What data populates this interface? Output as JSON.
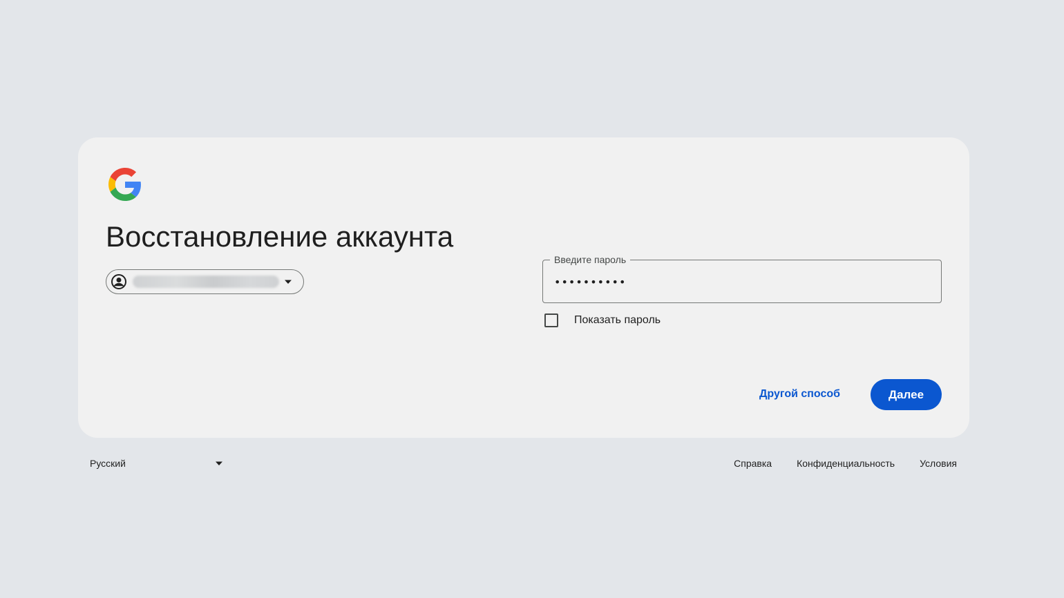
{
  "card": {
    "heading": "Восстановление аккаунта",
    "account": {
      "email": ""
    },
    "password_field": {
      "label": "Введите пароль",
      "value": "••••••••••"
    },
    "show_password": {
      "label": "Показать пароль",
      "checked": false
    },
    "actions": {
      "other_way_label": "Другой способ",
      "next_label": "Далее"
    }
  },
  "footer": {
    "language": "Русский",
    "links": {
      "help": "Справка",
      "privacy": "Конфиденциальность",
      "terms": "Условия"
    }
  },
  "colors": {
    "page_background": "#e3e6ea",
    "card_background": "#f1f1f1",
    "accent": "#0b57d0",
    "text": "#1f1f1f"
  },
  "icons": {
    "logo": "google-g-logo",
    "account": "account-circle-icon",
    "dropdown": "arrow-drop-down-icon"
  }
}
